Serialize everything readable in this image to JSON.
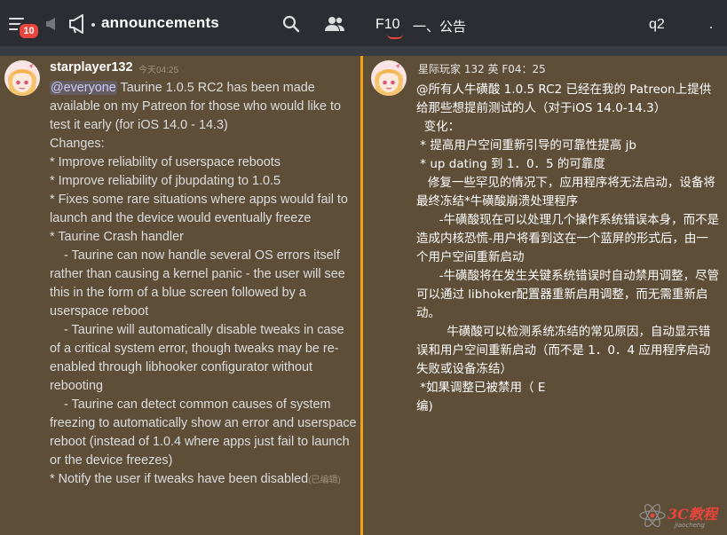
{
  "header": {
    "notification_count": "10",
    "channel_name": "announcements",
    "overlay_f10": "F10",
    "overlay_title": "一、公告",
    "overlay_q2": "q2"
  },
  "left_message": {
    "username": "starplayer132",
    "timestamp": "今天04:25",
    "mention": "@everyone",
    "paragraphs": [
      " Taurine 1.0.5 RC2 has been made available on my Patreon for those who would like to test it early (for iOS 14.0 - 14.3)",
      "",
      "Changes:",
      "",
      "* Improve reliability of userspace reboots",
      "* Improve reliability of jbupdating to 1.0.5",
      "* Fixes some rare situations where apps would fail to launch and the device would eventually freeze",
      "* Taurine Crash handler",
      "    - Taurine can now handle several OS errors itself rather than causing a kernel panic - the user will see this in the form of a blue screen followed by a userspace reboot",
      "    - Taurine will automatically disable tweaks in case of a critical system error, though tweaks may be re-enabled through libhooker configurator without rebooting",
      "    - Taurine can detect common causes of system freezing to automatically show an error and userspace reboot (instead of 1.0.4 where apps just fail to launch or the device freezes)",
      "* Notify the user if tweaks have been disabled"
    ],
    "edited": "(已编辑)"
  },
  "right_message": {
    "header": "星际玩家 132 英 F04：25",
    "paragraphs": [
      "@所有人牛磺酸 1.0.5 RC2 已经在我的 Patreon上提供给那些想提前测试的人（对于iOS 14.0-14.3）",
      "",
      "  变化：",
      "",
      " * 提高用户空间重新引导的可靠性提高 jb",
      " * up dating 到 1．0．5 的可靠度",
      "",
      "   修复一些罕见的情况下，应用程序将无法启动，设备将最终冻结*牛磺酸崩溃处理程序",
      "",
      "",
      "      -牛磺酸现在可以处理几个操作系统错误本身，而不是造成内核恐慌-用户将看到这在一个蓝屏的形式后，由一个用户空间重新启动",
      "",
      "",
      "      -牛磺酸将在发生关键系统错误时自动禁用调整，尽管可以通过 libhoker配置器重新启用调整，而无需重新启动。",
      "",
      "",
      "        牛磺酸可以检测系统冻结的常见原因，自动显示错误和用户空间重新启动（而不是 1．0．4 应用程序启动失败或设备冻结）",
      "",
      " *如果调整已被禁用（ E",
      "编)"
    ]
  },
  "watermark": {
    "text": "3C教程",
    "sub": "jiaocheng"
  },
  "icons": [
    "menu-icon",
    "megaphone-icon",
    "search-icon",
    "members-icon",
    "atom-logo-icon"
  ],
  "colors": {
    "accent_divider": "#f0a21a",
    "badge_red": "#e8453c",
    "panel_bg": "#5f4e37",
    "topbar_bg": "#2b2d32"
  }
}
